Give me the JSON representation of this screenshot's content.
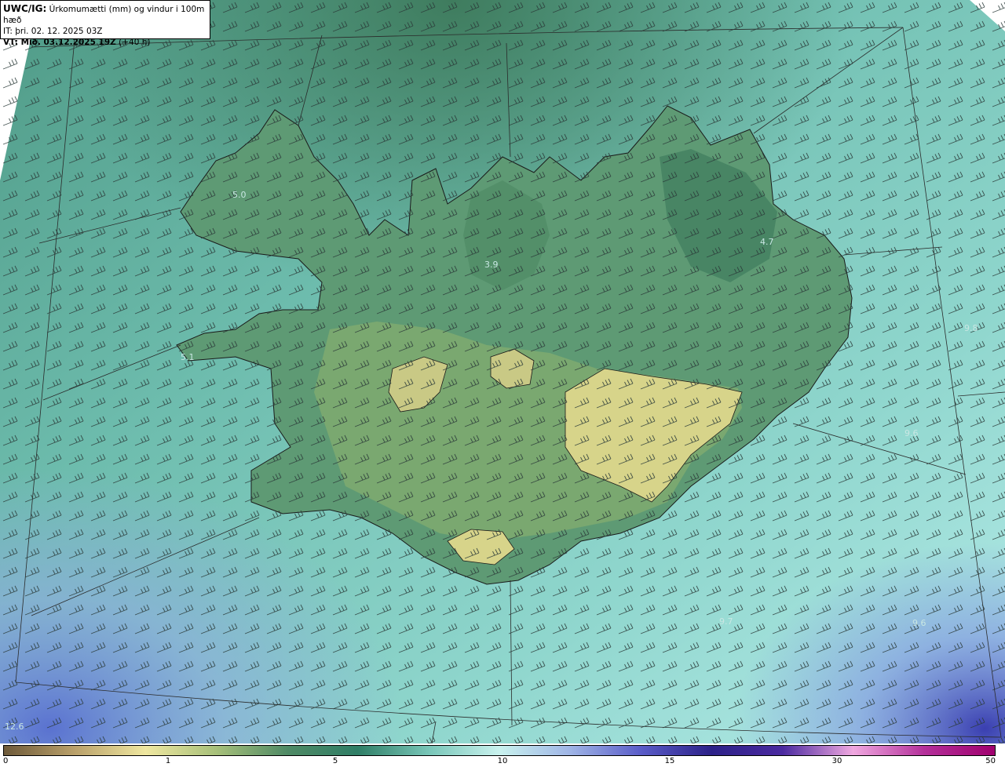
{
  "info": {
    "model": "UWC/IG:",
    "title": "Úrkomumætti (mm) og vindur i 100m hæð",
    "it_line": "IT: þri. 02. 12. 2025 03Z",
    "vt_label": "VT: Mið. 03.12.2025 19Z",
    "vt_lead": "(+40 h)"
  },
  "map_labels": [
    "5.0",
    "4.7",
    "3.9",
    "5.1",
    "9.8",
    "9.6",
    "9.7",
    "9.6",
    "12.6"
  ],
  "colorbar": {
    "ticks": [
      "0",
      "1",
      "5",
      "10",
      "15",
      "30",
      "50"
    ],
    "colors": [
      "#6e5a3a",
      "#b9a06a",
      "#efe7a0",
      "#a7c07a",
      "#4f8a65",
      "#2f7e66",
      "#78c6b8",
      "#c9f2ee",
      "#9fb5e6",
      "#5a5cc8",
      "#2c2188",
      "#4b2aa0",
      "#f0a8e0",
      "#b4309a",
      "#a0006e"
    ]
  }
}
